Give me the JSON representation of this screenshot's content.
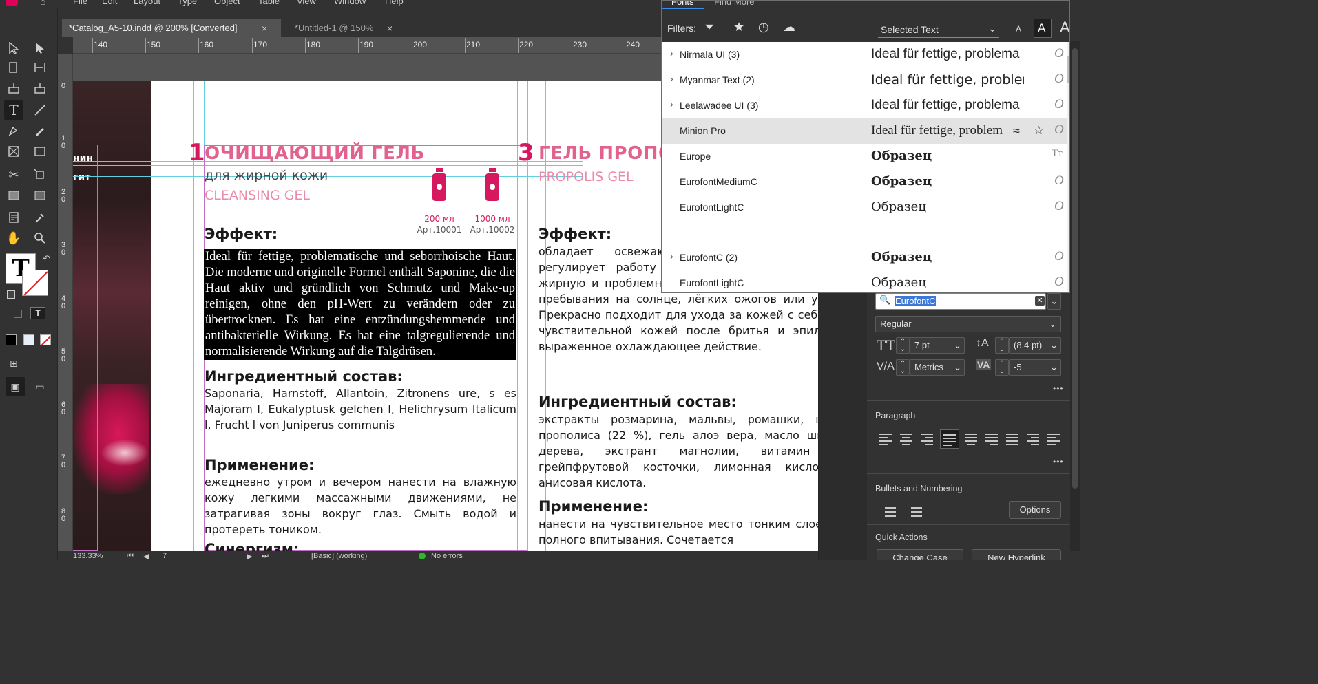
{
  "menubar": {
    "items": [
      "File",
      "Edit",
      "Layout",
      "Type",
      "Object",
      "Table",
      "View",
      "Window",
      "Help"
    ]
  },
  "doc_tabs": [
    {
      "title": "*Catalog_A5-10.indd @ 200% [Converted]",
      "close": "×"
    },
    {
      "title": "*Untitled-1 @ 150%",
      "close": "×"
    }
  ],
  "ruler": {
    "h_ticks": [
      "140",
      "150",
      "160",
      "170",
      "180",
      "190",
      "200",
      "210",
      "220",
      "230",
      "240"
    ],
    "v_ticks": [
      "0",
      "10",
      "20",
      "30",
      "40",
      "50",
      "60",
      "70",
      "80"
    ]
  },
  "document": {
    "num1": "1",
    "title1": "ОЧИЩАЮЩИЙ ГЕЛЬ",
    "sub_ru": "для жирной кожи",
    "sub_en": "CLEANSING GEL",
    "vol1": "200 мл",
    "art1": "Арт.10001",
    "vol2": "1000 мл",
    "art2": "Арт.10002",
    "effect_h": "Эффект:",
    "effect_text": "Ideal für fettige, problematische und seborrhoische Haut. Die moderne und originelle Formel enthält Saponine, die die Haut aktiv und gründlich von Schmutz und Make-up reinigen, ohne den pH-Wert zu verändern oder zu übertrocknen. Es hat eine entzündungshemmende und antibakterielle Wirkung. Es hat eine talgregulierende und normalisierende Wirkung auf die Talgdrüsen.",
    "ingr_h": "Ингредиентный состав:",
    "ingr_text": "Saponaria, Harnstoff, Allantoin, Zitronens ure, s es Majoram l, Eukalyptusk gelchen l, Helichrysum Italicum l, Frucht l von Juniperus communis",
    "apply_h": "Применение:",
    "apply_text": "ежедневно утром и вечером нанести на влажную кожу легкими массажными движениями, не затрагивая зоны вокруг глаз. Смыть водой и протереть тоником.",
    "next_h": "Синергизм:",
    "num3": "3",
    "title3": "ГЕЛЬ ПРОПОЛИС",
    "sub3_en": "PROPOLIS GEL",
    "effect3_h": "Эффект:",
    "effect3_text": "обладает освежающим и успокаивающим действием, регулирует работу сальных желез. Идеально подходит на жирную и проблемную кожу. Снимает чувствительность после пребывания на солнце, лёгких ожогов или укусов насекомых. Прекрасно подходит для ухода за кожей с себореей, а также за чувствительной кожей после бритья и эпиляции. Оказывает выраженное охлаждающее действие.",
    "ingr3_h": "Ингредиентный состав:",
    "ingr3_text": "экстракты розмарина, мальвы, ромашки, шалфея, черного прополиса (22 %), гель алоэ вера, масло ши, масло чайного дерева, экстрант магнолии, витамин B5, экстрант грейпфрутовой косточки, лимонная кислота, витамин Е, анисовая кислота.",
    "apply3_h": "Применение:",
    "apply3_text": "нанести на чувствительное место тонким слоем, подождать до полного впитывания. Сочетается",
    "photo_text_1": "нин",
    "photo_text_2": "гит"
  },
  "statusbar": {
    "zoom": "133.33%",
    "page": "7",
    "style": "[Basic] (working)",
    "errors": "No errors"
  },
  "font_panel": {
    "tabs": [
      "Fonts",
      "Find More"
    ],
    "filters_label": "Filters:",
    "selected_text": "Selected Text",
    "size_small": "A",
    "size_med": "A",
    "size_large": "A",
    "rows": [
      {
        "chev": "›",
        "name": "Nirmala UI (3)",
        "preview": "Ideal für fettige, problema",
        "type": "O"
      },
      {
        "chev": "›",
        "name": "Myanmar Text (2)",
        "preview": "Ideal für fettige, problem",
        "type": "O"
      },
      {
        "chev": "›",
        "name": "Leelawadee UI (3)",
        "preview": "Ideal für fettige, problema",
        "type": "O"
      },
      {
        "chev": "",
        "name": "Minion Pro",
        "preview": "Ideal für fettige, problem",
        "type": "O"
      },
      {
        "chev": "",
        "name": "Europe",
        "preview": "Образец",
        "type": "Tт"
      },
      {
        "chev": "",
        "name": "EurofontMediumC",
        "preview": "Образец",
        "type": "O"
      },
      {
        "chev": "",
        "name": "EurofontLightC",
        "preview": "Образец",
        "type": "O"
      },
      {
        "chev": "›",
        "name": "EurofontC (2)",
        "preview": "Образец",
        "type": "O"
      },
      {
        "chev": "",
        "name": "EurofontLightC",
        "preview": "Образец",
        "type": "O"
      }
    ]
  },
  "props": {
    "font_value": "EurofontC",
    "style_value": "Regular",
    "size_value": "7 pt",
    "leading_value": "(8.4 pt)",
    "kerning_value": "Metrics",
    "tracking_value": "-5",
    "paragraph_label": "Paragraph",
    "bullets_label": "Bullets and Numbering",
    "options_label": "Options",
    "quick_actions_label": "Quick Actions",
    "change_case_label": "Change Case",
    "new_hyperlink_label": "New Hyperlink",
    "more": "•••"
  },
  "colors": {
    "accent_pink": "#d6195e",
    "light_pink": "#ec8ba8",
    "guide_cyan": "#60d0e0",
    "frame_magenta": "#c270c6"
  }
}
